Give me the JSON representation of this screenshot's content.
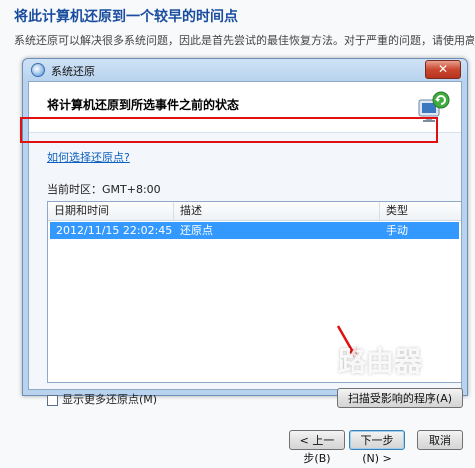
{
  "page": {
    "title": "将此计算机还原到一个较早的时间点",
    "description": "系统还原可以解决很多系统问题，因此是首先尝试的最佳恢复方法。对于严重的问题，请使用高级恢复方"
  },
  "window": {
    "title": "系统还原",
    "close_label": "✕",
    "header_title": "将计算机还原到所选事件之前的状态",
    "help_link": "如何选择还原点?",
    "timezone_label": "当前时区：GMT+8:00"
  },
  "grid": {
    "columns": [
      "日期和时间",
      "描述",
      "类型"
    ],
    "rows": [
      {
        "date": "2012/11/15 22:02:45",
        "desc": "还原点",
        "type": "手动",
        "selected": true
      }
    ]
  },
  "more_restore_points": {
    "label": "显示更多还原点(M)",
    "checked": false
  },
  "buttons": {
    "scan": "扫描受影响的程序(A)",
    "back": "< 上一步(B)",
    "next": "下一步(N) >",
    "cancel": "取消"
  },
  "watermark": {
    "text": "路由器",
    "sub": "luyouqi.com"
  },
  "colors": {
    "selection": "#3399ff",
    "highlight_box": "#e01010",
    "link": "#0a5fbf"
  }
}
